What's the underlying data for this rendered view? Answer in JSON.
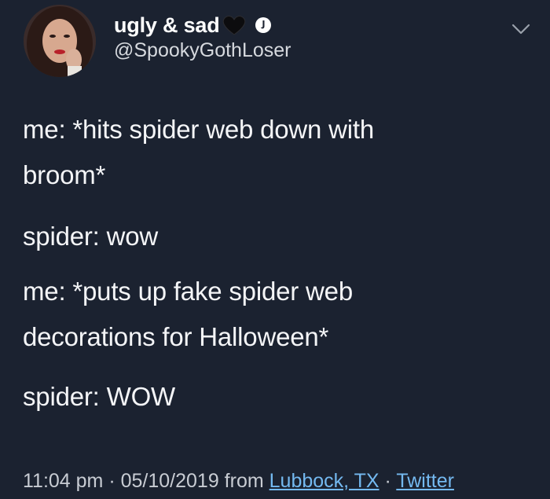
{
  "author": {
    "display_name": "ugly & sad",
    "handle": "@SpookyGothLoser"
  },
  "tweet": {
    "lines": [
      "me: *hits spider web down with",
      "broom*",
      "spider: wow",
      "me: *puts up fake spider web",
      "decorations for Halloween*",
      "spider: WOW"
    ]
  },
  "meta": {
    "time": "11:04 pm",
    "sep1": " · ",
    "date": "05/10/2019",
    "from": " from ",
    "location": "Lubbock, TX",
    "sep2": " · ",
    "source": "Twitter"
  },
  "icons": {
    "heart": "black-heart-icon",
    "verified": "verified-badge-icon",
    "menu": "chevron-down-icon"
  },
  "colors": {
    "background": "#1b2230",
    "text": "#f4f5f7",
    "link": "#74b9f0"
  }
}
